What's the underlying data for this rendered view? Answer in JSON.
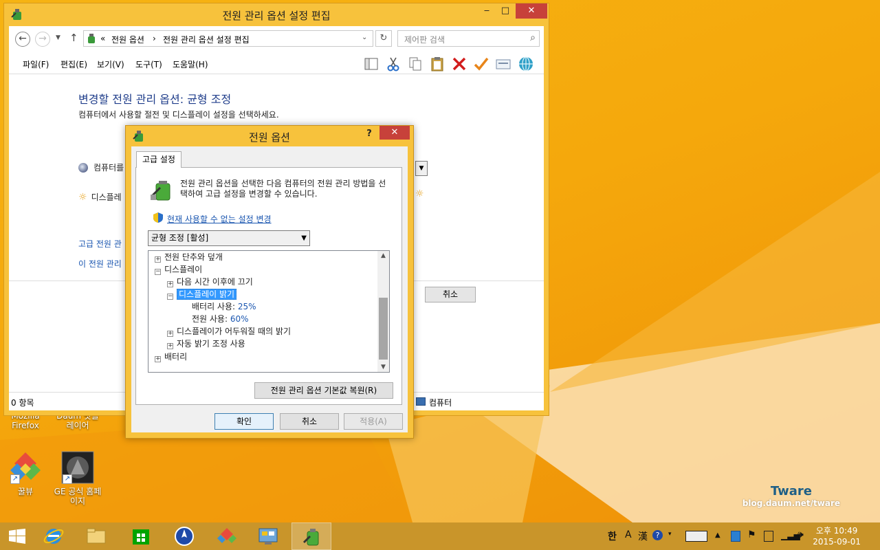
{
  "explorer": {
    "title": "전원 관리 옵션 설정 편집",
    "breadcrumb_prefix": "«",
    "breadcrumb_1": "전원 옵션",
    "breadcrumb_sep": "›",
    "breadcrumb_2": "전원 관리 옵션 설정 편집",
    "search_placeholder": "제어판 검색",
    "menu": [
      "파일(F)",
      "편집(E)",
      "보기(V)",
      "도구(T)",
      "도움말(H)"
    ],
    "heading": "변경할 전원 관리 옵션: 균형 조정",
    "description": "컴퓨터에서 사용할 절전 및 디스플레이 설정을 선택하세요.",
    "row_sleep": "컴퓨터를",
    "row_display": "디스플레",
    "link_advanced": "고급 전원 관",
    "link_restore": "이 전원 관리",
    "cancel": "취소",
    "status_items": "0 항목",
    "status_computer": "컴퓨터"
  },
  "dialog": {
    "title": "전원 옵션",
    "help": "?",
    "tab": "고급 설정",
    "intro": "전원 관리 옵션을 선택한 다음 컴퓨터의 전원 관리 방법을 선택하여 고급 설정을 변경할 수 있습니다.",
    "change_link": "현재 사용할 수 없는 설정 변경",
    "plan": "균형 조정 [활성]",
    "tree": {
      "power_buttons": "전원 단추와 덮개",
      "display": "디스플레이",
      "turn_off_after": "다음 시간 이후에 끄기",
      "brightness": "디스플레이 밝기",
      "battery_label": "배터리 사용:",
      "battery_value": "25%",
      "plugged_label": "전원 사용:",
      "plugged_value": "60%",
      "dimmed_brightness": "디스플레이가 어두워질 때의 밝기",
      "adaptive_brightness": "자동 밝기 조정 사용",
      "battery": "배터리"
    },
    "restore_defaults": "전원 관리 옵션 기본값 복원(R)",
    "ok": "확인",
    "cancel": "취소",
    "apply": "적용(A)"
  },
  "desktop": {
    "icons": [
      {
        "label": "Mozilla Firefox"
      },
      {
        "label": "Daum 팟플레이어"
      },
      {
        "label": "꿀뷰"
      },
      {
        "label": "GE 공식 홈페이지"
      }
    ],
    "watermark_title": "Tware",
    "watermark_url": "blog.daum.net/tware"
  },
  "taskbar": {
    "ime_hangul": "한",
    "ime_a": "A",
    "ime_hanja": "漢",
    "clock_ampm_time": "오후 10:49",
    "clock_date": "2015-09-01"
  },
  "colors": {
    "desktop_bg": "#f5a80c",
    "window_frame": "#f7c23c",
    "link": "#1a56b0",
    "heading": "#1e3c8a",
    "selection": "#3399ff",
    "close": "#c7413a"
  }
}
